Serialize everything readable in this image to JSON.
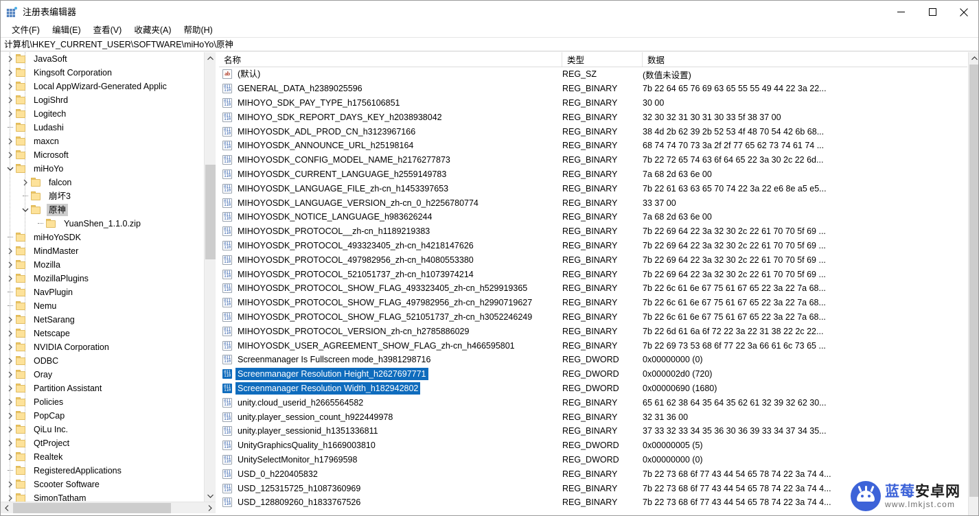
{
  "window": {
    "title": "注册表编辑器",
    "icon": "registry-icon",
    "minimize_label": "最小化",
    "maximize_label": "最大化",
    "close_label": "关闭"
  },
  "menu": {
    "items": [
      {
        "label": "文件(F)",
        "name": "menu-file"
      },
      {
        "label": "编辑(E)",
        "name": "menu-edit"
      },
      {
        "label": "查看(V)",
        "name": "menu-view"
      },
      {
        "label": "收藏夹(A)",
        "name": "menu-favorites"
      },
      {
        "label": "帮助(H)",
        "name": "menu-help"
      }
    ]
  },
  "address": {
    "path": "计算机\\HKEY_CURRENT_USER\\SOFTWARE\\miHoYo\\原神"
  },
  "tree": {
    "nodes": [
      {
        "label": "JavaSoft",
        "depth": 2,
        "expander": "collapsed",
        "selected": false
      },
      {
        "label": "Kingsoft Corporation",
        "depth": 2,
        "expander": "collapsed",
        "selected": false
      },
      {
        "label": "Local AppWizard-Generated Applic",
        "depth": 2,
        "expander": "collapsed",
        "selected": false
      },
      {
        "label": "LogiShrd",
        "depth": 2,
        "expander": "collapsed",
        "selected": false
      },
      {
        "label": "Logitech",
        "depth": 2,
        "expander": "collapsed",
        "selected": false
      },
      {
        "label": "Ludashi",
        "depth": 2,
        "expander": "leaf",
        "selected": false
      },
      {
        "label": "maxcn",
        "depth": 2,
        "expander": "collapsed",
        "selected": false
      },
      {
        "label": "Microsoft",
        "depth": 2,
        "expander": "collapsed",
        "selected": false
      },
      {
        "label": "miHoYo",
        "depth": 2,
        "expander": "expanded",
        "selected": false
      },
      {
        "label": "falcon",
        "depth": 3,
        "expander": "collapsed",
        "selected": false
      },
      {
        "label": "崩坏3",
        "depth": 3,
        "expander": "leaf",
        "selected": false
      },
      {
        "label": "原神",
        "depth": 3,
        "expander": "expanded",
        "selected": true
      },
      {
        "label": "YuanShen_1.1.0.zip",
        "depth": 4,
        "expander": "leaf",
        "selected": false
      },
      {
        "label": "miHoYoSDK",
        "depth": 2,
        "expander": "leaf",
        "selected": false
      },
      {
        "label": "MindMaster",
        "depth": 2,
        "expander": "collapsed",
        "selected": false
      },
      {
        "label": "Mozilla",
        "depth": 2,
        "expander": "collapsed",
        "selected": false
      },
      {
        "label": "MozillaPlugins",
        "depth": 2,
        "expander": "collapsed",
        "selected": false
      },
      {
        "label": "NavPlugin",
        "depth": 2,
        "expander": "leaf",
        "selected": false
      },
      {
        "label": "Nemu",
        "depth": 2,
        "expander": "leaf",
        "selected": false
      },
      {
        "label": "NetSarang",
        "depth": 2,
        "expander": "collapsed",
        "selected": false
      },
      {
        "label": "Netscape",
        "depth": 2,
        "expander": "collapsed",
        "selected": false
      },
      {
        "label": "NVIDIA Corporation",
        "depth": 2,
        "expander": "collapsed",
        "selected": false
      },
      {
        "label": "ODBC",
        "depth": 2,
        "expander": "collapsed",
        "selected": false
      },
      {
        "label": "Oray",
        "depth": 2,
        "expander": "collapsed",
        "selected": false
      },
      {
        "label": "Partition Assistant",
        "depth": 2,
        "expander": "collapsed",
        "selected": false
      },
      {
        "label": "Policies",
        "depth": 2,
        "expander": "collapsed",
        "selected": false
      },
      {
        "label": "PopCap",
        "depth": 2,
        "expander": "collapsed",
        "selected": false
      },
      {
        "label": "QiLu Inc.",
        "depth": 2,
        "expander": "collapsed",
        "selected": false
      },
      {
        "label": "QtProject",
        "depth": 2,
        "expander": "collapsed",
        "selected": false
      },
      {
        "label": "Realtek",
        "depth": 2,
        "expander": "collapsed",
        "selected": false
      },
      {
        "label": "RegisteredApplications",
        "depth": 2,
        "expander": "leaf",
        "selected": false
      },
      {
        "label": "Scooter Software",
        "depth": 2,
        "expander": "collapsed",
        "selected": false
      },
      {
        "label": "SimonTatham",
        "depth": 2,
        "expander": "collapsed",
        "selected": false
      }
    ]
  },
  "list": {
    "columns": [
      {
        "label": "名称",
        "name": "column-name"
      },
      {
        "label": "类型",
        "name": "column-type"
      },
      {
        "label": "数据",
        "name": "column-data"
      }
    ],
    "rows": [
      {
        "name": "(默认)",
        "type": "REG_SZ",
        "data": "(数值未设置)",
        "icon": "string-value-icon",
        "selected": false
      },
      {
        "name": "GENERAL_DATA_h2389025596",
        "type": "REG_BINARY",
        "data": "7b 22 64 65 76 69 63 65 55 55 49 44 22 3a 22...",
        "icon": "binary-value-icon",
        "selected": false
      },
      {
        "name": "MIHOYO_SDK_PAY_TYPE_h1756106851",
        "type": "REG_BINARY",
        "data": "30 00",
        "icon": "binary-value-icon",
        "selected": false
      },
      {
        "name": "MIHOYO_SDK_REPORT_DAYS_KEY_h2038938042",
        "type": "REG_BINARY",
        "data": "32 30 32 31 30 31 30 33 5f 38 37 00",
        "icon": "binary-value-icon",
        "selected": false
      },
      {
        "name": "MIHOYOSDK_ADL_PROD_CN_h3123967166",
        "type": "REG_BINARY",
        "data": "38 4d 2b 62 39 2b 52 53 4f 48 70 54 42 6b 68...",
        "icon": "binary-value-icon",
        "selected": false
      },
      {
        "name": "MIHOYOSDK_ANNOUNCE_URL_h25198164",
        "type": "REG_BINARY",
        "data": "68 74 74 70 73 3a 2f 2f 77 65 62 73 74 61 74 ...",
        "icon": "binary-value-icon",
        "selected": false
      },
      {
        "name": "MIHOYOSDK_CONFIG_MODEL_NAME_h2176277873",
        "type": "REG_BINARY",
        "data": "7b 22 72 65 74 63 6f 64 65 22 3a 30 2c 22 6d...",
        "icon": "binary-value-icon",
        "selected": false
      },
      {
        "name": "MIHOYOSDK_CURRENT_LANGUAGE_h2559149783",
        "type": "REG_BINARY",
        "data": "7a 68 2d 63 6e 00",
        "icon": "binary-value-icon",
        "selected": false
      },
      {
        "name": "MIHOYOSDK_LANGUAGE_FILE_zh-cn_h1453397653",
        "type": "REG_BINARY",
        "data": "7b 22 61 63 63 65 70 74 22 3a 22 e6 8e a5 e5...",
        "icon": "binary-value-icon",
        "selected": false
      },
      {
        "name": "MIHOYOSDK_LANGUAGE_VERSION_zh-cn_0_h2256780774",
        "type": "REG_BINARY",
        "data": "33 37 00",
        "icon": "binary-value-icon",
        "selected": false
      },
      {
        "name": "MIHOYOSDK_NOTICE_LANGUAGE_h983626244",
        "type": "REG_BINARY",
        "data": "7a 68 2d 63 6e 00",
        "icon": "binary-value-icon",
        "selected": false
      },
      {
        "name": "MIHOYOSDK_PROTOCOL__zh-cn_h1189219383",
        "type": "REG_BINARY",
        "data": "7b 22 69 64 22 3a 32 30 2c 22 61 70 70 5f 69 ...",
        "icon": "binary-value-icon",
        "selected": false
      },
      {
        "name": "MIHOYOSDK_PROTOCOL_493323405_zh-cn_h4218147626",
        "type": "REG_BINARY",
        "data": "7b 22 69 64 22 3a 32 30 2c 22 61 70 70 5f 69 ...",
        "icon": "binary-value-icon",
        "selected": false
      },
      {
        "name": "MIHOYOSDK_PROTOCOL_497982956_zh-cn_h4080553380",
        "type": "REG_BINARY",
        "data": "7b 22 69 64 22 3a 32 30 2c 22 61 70 70 5f 69 ...",
        "icon": "binary-value-icon",
        "selected": false
      },
      {
        "name": "MIHOYOSDK_PROTOCOL_521051737_zh-cn_h1073974214",
        "type": "REG_BINARY",
        "data": "7b 22 69 64 22 3a 32 30 2c 22 61 70 70 5f 69 ...",
        "icon": "binary-value-icon",
        "selected": false
      },
      {
        "name": "MIHOYOSDK_PROTOCOL_SHOW_FLAG_493323405_zh-cn_h529919365",
        "type": "REG_BINARY",
        "data": "7b 22 6c 61 6e 67 75 61 67 65 22 3a 22 7a 68...",
        "icon": "binary-value-icon",
        "selected": false
      },
      {
        "name": "MIHOYOSDK_PROTOCOL_SHOW_FLAG_497982956_zh-cn_h2990719627",
        "type": "REG_BINARY",
        "data": "7b 22 6c 61 6e 67 75 61 67 65 22 3a 22 7a 68...",
        "icon": "binary-value-icon",
        "selected": false
      },
      {
        "name": "MIHOYOSDK_PROTOCOL_SHOW_FLAG_521051737_zh-cn_h3052246249",
        "type": "REG_BINARY",
        "data": "7b 22 6c 61 6e 67 75 61 67 65 22 3a 22 7a 68...",
        "icon": "binary-value-icon",
        "selected": false
      },
      {
        "name": "MIHOYOSDK_PROTOCOL_VERSION_zh-cn_h2785886029",
        "type": "REG_BINARY",
        "data": "7b 22 6d 61 6a 6f 72 22 3a 22 31 38 22 2c 22...",
        "icon": "binary-value-icon",
        "selected": false
      },
      {
        "name": "MIHOYOSDK_USER_AGREEMENT_SHOW_FLAG_zh-cn_h466595801",
        "type": "REG_BINARY",
        "data": "7b 22 69 73 53 68 6f 77 22 3a 66 61 6c 73 65 ...",
        "icon": "binary-value-icon",
        "selected": false
      },
      {
        "name": "Screenmanager Is Fullscreen mode_h3981298716",
        "type": "REG_DWORD",
        "data": "0x00000000 (0)",
        "icon": "binary-value-icon",
        "selected": false
      },
      {
        "name": "Screenmanager Resolution Height_h2627697771",
        "type": "REG_DWORD",
        "data": "0x000002d0 (720)",
        "icon": "binary-value-icon",
        "selected": true
      },
      {
        "name": "Screenmanager Resolution Width_h182942802",
        "type": "REG_DWORD",
        "data": "0x00000690 (1680)",
        "icon": "binary-value-icon",
        "selected": true
      },
      {
        "name": "unity.cloud_userid_h2665564582",
        "type": "REG_BINARY",
        "data": "65 61 62 38 64 35 64 35 62 61 32 39 32 62 30...",
        "icon": "binary-value-icon",
        "selected": false
      },
      {
        "name": "unity.player_session_count_h922449978",
        "type": "REG_BINARY",
        "data": "32 31 36 00",
        "icon": "binary-value-icon",
        "selected": false
      },
      {
        "name": "unity.player_sessionid_h1351336811",
        "type": "REG_BINARY",
        "data": "37 33 32 33 34 35 36 30 36 39 33 34 37 34 35...",
        "icon": "binary-value-icon",
        "selected": false
      },
      {
        "name": "UnityGraphicsQuality_h1669003810",
        "type": "REG_DWORD",
        "data": "0x00000005 (5)",
        "icon": "binary-value-icon",
        "selected": false
      },
      {
        "name": "UnitySelectMonitor_h17969598",
        "type": "REG_DWORD",
        "data": "0x00000000 (0)",
        "icon": "binary-value-icon",
        "selected": false
      },
      {
        "name": "USD_0_h220405832",
        "type": "REG_BINARY",
        "data": "7b 22 73 68 6f 77 43 44 54 65 78 74 22 3a 74 4...",
        "icon": "binary-value-icon",
        "selected": false
      },
      {
        "name": "USD_125315725_h1087360969",
        "type": "REG_BINARY",
        "data": "7b 22 73 68 6f 77 43 44 54 65 78 74 22 3a 74 4...",
        "icon": "binary-value-icon",
        "selected": false
      },
      {
        "name": "USD_128809260_h1833767526",
        "type": "REG_BINARY",
        "data": "7b 22 73 68 6f 77 43 44 54 65 78 74 22 3a 74 4...",
        "icon": "binary-value-icon",
        "selected": false
      }
    ]
  },
  "watermark": {
    "brand_blue": "蓝莓",
    "brand_black": "安卓网",
    "url": "www.lmkjst.com",
    "accent_color": "#3d63d8"
  }
}
